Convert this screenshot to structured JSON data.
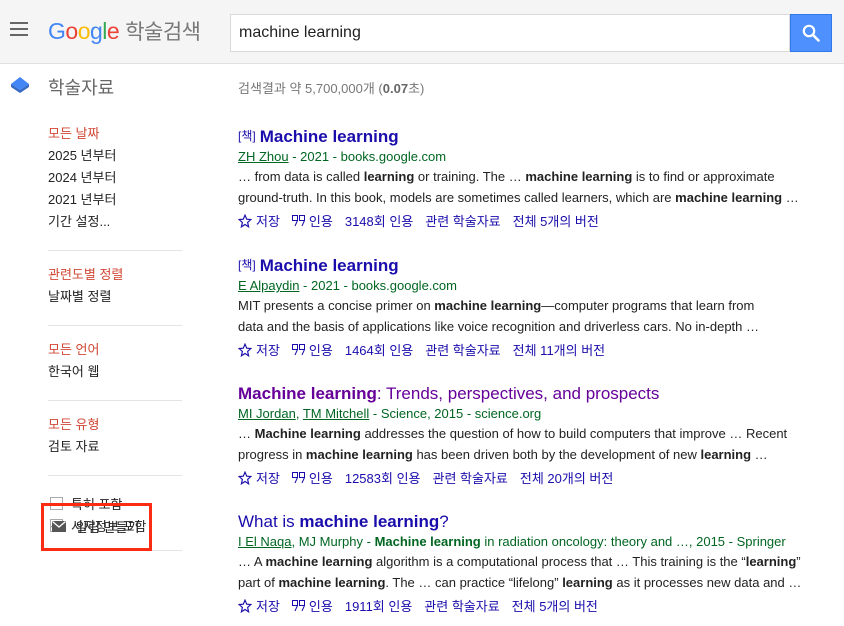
{
  "header": {
    "logo_letters": [
      "G",
      "o",
      "o",
      "g",
      "l",
      "e"
    ],
    "logo_suffix": "학술검색",
    "search_value": "machine learning"
  },
  "subbar": {
    "section_title": "학술자료",
    "stats_prefix": "검색결과 약 5,700,000개 (",
    "stats_time": "0.07",
    "stats_suffix": "초)"
  },
  "sidebar": {
    "date_items": [
      "모든 날짜",
      "2025 년부터",
      "2024 년부터",
      "2021 년부터",
      "기간 설정..."
    ],
    "sort_items": [
      "관련도별 정렬",
      "날짜별 정렬"
    ],
    "lang_items": [
      "모든 언어",
      "한국어 웹"
    ],
    "type_items": [
      "모든 유형",
      "검토 자료"
    ],
    "checks": [
      {
        "label": "특허 포함",
        "checked": false
      },
      {
        "label": "서지정보 포함",
        "checked": true
      }
    ],
    "alert_label": "알림 만들기"
  },
  "results": [
    {
      "tag": "[책]",
      "title_bold": "Machine learning",
      "title_rest": "",
      "authors": [
        "ZH Zhou"
      ],
      "meta_rest": " - 2021 - books.google.com",
      "snippet1": [
        "… from data is called ",
        "learning",
        " or training. The … ",
        "machine learning",
        " is to find or approximate"
      ],
      "snippet2": [
        "ground-truth. In this book, models are sometimes called learners, which are ",
        "machine learning",
        " …"
      ],
      "links": [
        "저장",
        "인용",
        "3148회 인용",
        "관련 학술자료",
        "전체 5개의 버전"
      ]
    },
    {
      "tag": "[책]",
      "title_bold": "Machine learning",
      "title_rest": "",
      "authors": [
        "E Alpaydin"
      ],
      "meta_rest": " - 2021 - books.google.com",
      "snippet1": [
        "MIT presents a concise primer on ",
        "machine learning",
        "—computer programs that learn from"
      ],
      "snippet2": [
        "data and the basis of applications like voice recognition and driverless cars. No in-depth …",
        "",
        ""
      ],
      "links": [
        "저장",
        "인용",
        "1464회 인용",
        "관련 학술자료",
        "전체 11개의 버전"
      ]
    },
    {
      "tag": "",
      "title_bold": "Machine learning",
      "title_rest": ": Trends, perspectives, and prospects",
      "authors": [
        "MI Jordan",
        "TM Mitchell"
      ],
      "meta_rest": " - Science, 2015 - science.org",
      "snippet1": [
        "… ",
        "Machine learning",
        " addresses the question of how to build computers that improve … Recent"
      ],
      "snippet2": [
        "progress in ",
        "machine learning",
        " has been driven both by the development of new ",
        "learning",
        " …"
      ],
      "links": [
        "저장",
        "인용",
        "12583회 인용",
        "관련 학술자료",
        "전체 20개의 버전"
      ]
    },
    {
      "tag": "",
      "title_pre": "What is ",
      "title_bold": "machine learning",
      "title_rest": "?",
      "authors": [
        "I El Naqa"
      ],
      "meta_rest": ", MJ Murphy - ",
      "meta_bold": "Machine learning",
      "meta_tail": " in radiation oncology: theory and …, 2015 - Springer",
      "snippet1": [
        "… A ",
        "machine learning",
        " algorithm is a computational process that … This training is the “",
        "learning",
        "”"
      ],
      "snippet2": [
        "part of ",
        "machine learning",
        ". The … can practice “lifelong” ",
        "learning",
        " as it processes new data and …"
      ],
      "links": [
        "저장",
        "인용",
        "1911회 인용",
        "관련 학술자료",
        "전체 5개의 버전"
      ]
    }
  ]
}
